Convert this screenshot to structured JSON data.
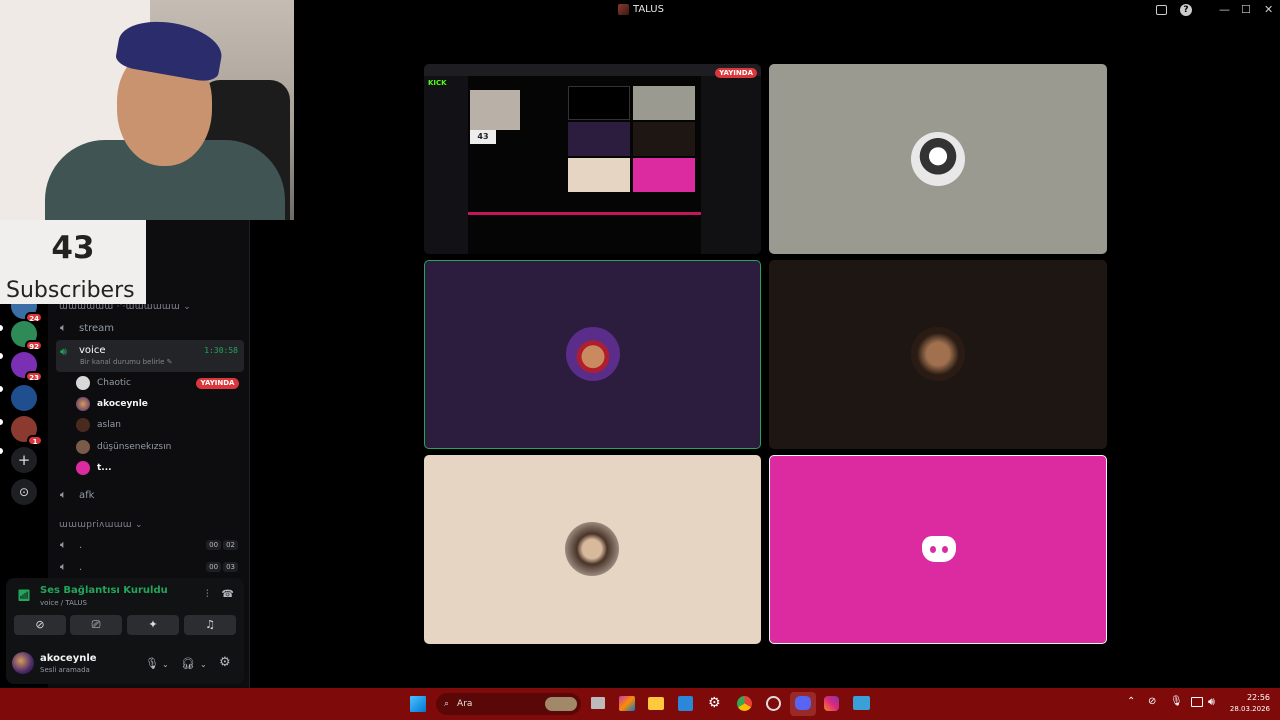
{
  "window": {
    "title": "TALUS"
  },
  "webcam_overlay": {
    "subscriber_count": "43",
    "subscriber_label": "Subscribers"
  },
  "servers": [
    {
      "badge": "24",
      "color": "#3a6ea5"
    },
    {
      "badge": "92",
      "color": "#2e8b57"
    },
    {
      "badge": "23",
      "color": "#7b2fb3"
    },
    {
      "badge": "",
      "color": "#1f4f8f"
    },
    {
      "badge": "1",
      "color": "#8b3a2f"
    }
  ],
  "rail_buttons": {
    "add": "+",
    "explore": "⊙"
  },
  "channels": {
    "category1_obscured": "ɯɯɯɯɯɯ ·'·ɯɯɯɯɯɯ ⌄",
    "stream": "stream",
    "voice": {
      "name": "voice",
      "timer": "1:30:58",
      "status": "Bir kanal durumu belirle ✎",
      "members": [
        {
          "name": "Chaotic",
          "badge": "YAYINDA"
        },
        {
          "name": "akoceynle",
          "badge": ""
        },
        {
          "name": "aslan",
          "badge": ""
        },
        {
          "name": "düşünsenekızsın",
          "badge": ""
        },
        {
          "name": "t...",
          "badge": ""
        }
      ]
    },
    "afk": "afk",
    "category2_obscured": "ɯɯɯpriʌɯɯɯ ⌄",
    "private_channels": [
      {
        "name": ".",
        "counter": [
          "00",
          "02"
        ]
      },
      {
        "name": ".",
        "counter": [
          "00",
          "03"
        ]
      }
    ]
  },
  "voice_panel": {
    "title": "Ses Bağlantısı Kuruldu",
    "subtitle": "voice / TALUS",
    "user": {
      "name": "akoceynle",
      "status": "Sesli aramada"
    }
  },
  "video_grid": {
    "live_badge": "YAYINDA",
    "preview_subscribers": "43",
    "tiles": [
      {
        "bg": "#9a9a90"
      },
      {
        "bg": "#2c1c3d"
      },
      {
        "bg": "#1e1613"
      },
      {
        "bg": "#e5d5c2"
      },
      {
        "bg": "#dc2aa0"
      }
    ]
  },
  "taskbar": {
    "search_placeholder": "Ara",
    "time": "22:56",
    "date": "28.03.2026"
  }
}
